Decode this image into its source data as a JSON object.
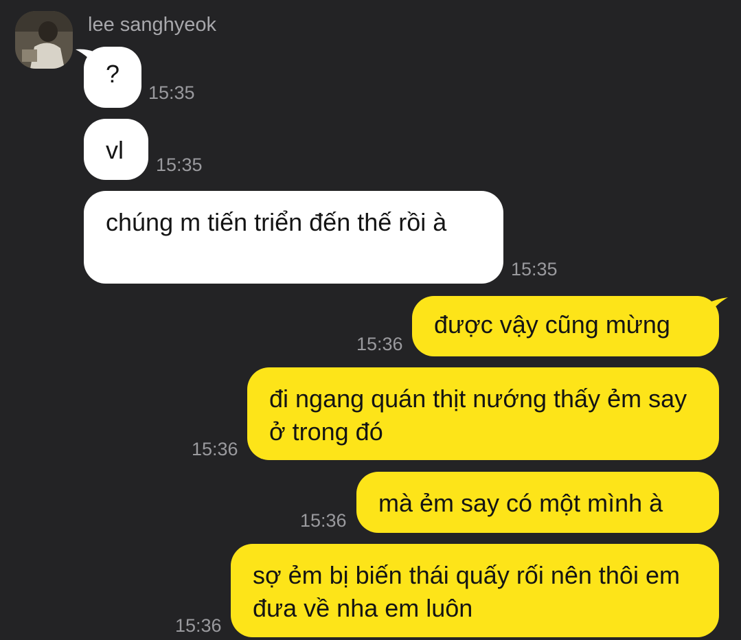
{
  "chat": {
    "sender_name": "lee sanghyeok",
    "avatar_icon": "user-avatar-photo",
    "colors": {
      "background": "#232325",
      "incoming_bubble": "#ffffff",
      "outgoing_bubble": "#fde419",
      "timestamp": "#9a9a9e"
    }
  },
  "messages": [
    {
      "direction": "incoming",
      "text": "?",
      "time": "15:35"
    },
    {
      "direction": "incoming",
      "text": "vl",
      "time": "15:35"
    },
    {
      "direction": "incoming",
      "text": "chúng m tiến triển đến thế rồi à",
      "time": "15:35"
    },
    {
      "direction": "outgoing",
      "text": "được vậy cũng mừng",
      "time": "15:36"
    },
    {
      "direction": "outgoing",
      "text": "đi ngang quán thịt nướng thấy ẻm say ở trong đó",
      "time": "15:36"
    },
    {
      "direction": "outgoing",
      "text": "mà ẻm say có một mình à",
      "time": "15:36"
    },
    {
      "direction": "outgoing",
      "text": "sợ ẻm bị biến thái quấy rối nên thôi em đưa về nha em luôn",
      "time": "15:36"
    }
  ]
}
